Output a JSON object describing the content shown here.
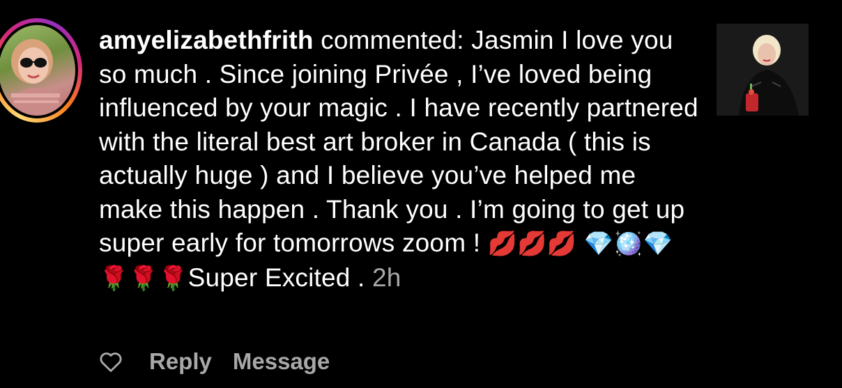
{
  "comment": {
    "username": "amyelizabethfrith",
    "action": " commented: ",
    "text": "Jasmin I love you so much . Since joining Privée , I’ve loved being influenced by your magic . I have recently partnered with the literal best art broker in Canada ( this is actually huge ) and I believe you’ve helped me make this happen . Thank you . I’m going to get up super early for tomorrows zoom ! ",
    "emojis_1": "💋💋💋",
    "emojis_2": "💎🪩💎🌹🌹🌹",
    "text_end": "Super Excited . ",
    "time": "2h"
  },
  "actions": {
    "reply_label": "Reply",
    "message_label": "Message"
  },
  "icons": {
    "like": "heart-icon"
  },
  "colors": {
    "background": "#000000",
    "text": "#ffffff",
    "muted": "#a8a8a8",
    "story_ring": [
      "#feda75",
      "#fa7e1e",
      "#d62976",
      "#962fbf"
    ]
  }
}
